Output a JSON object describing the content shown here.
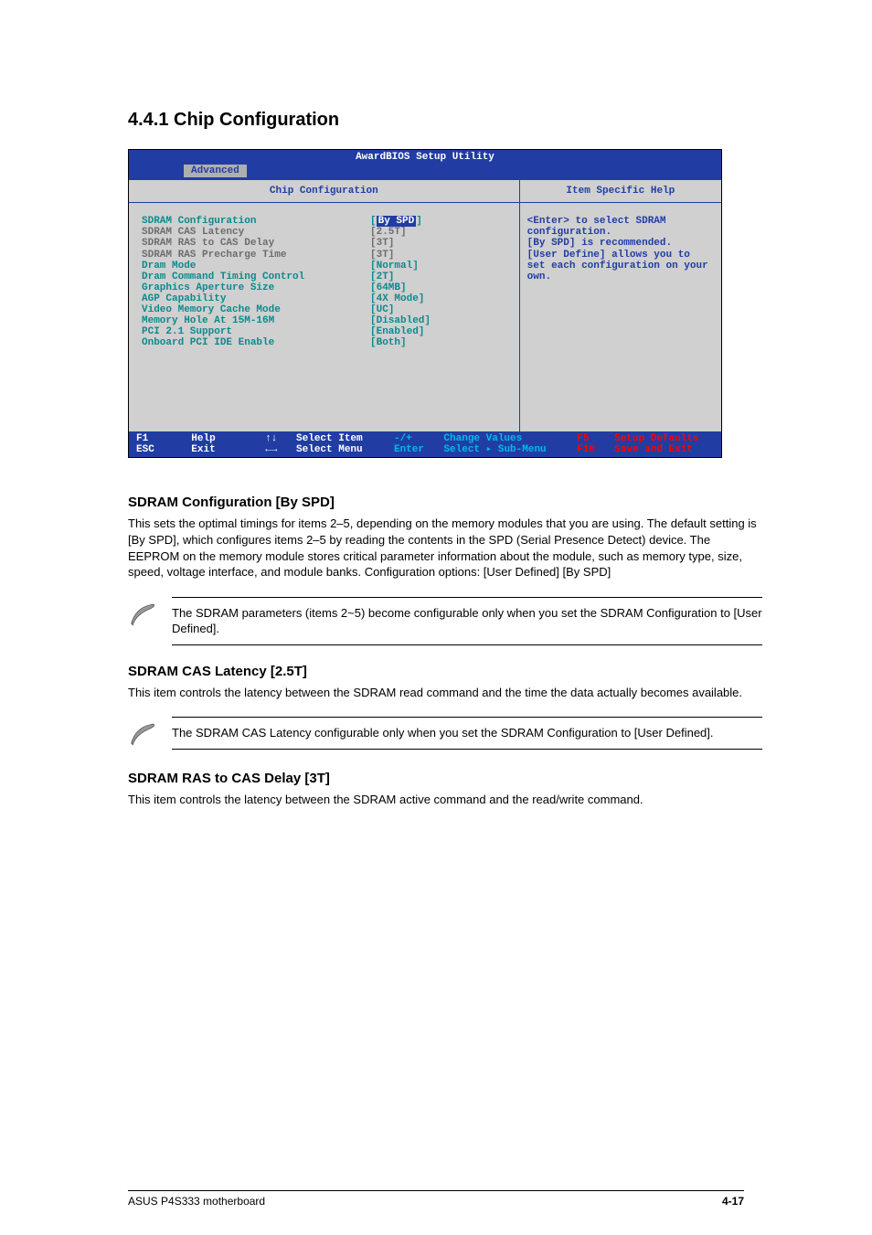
{
  "heading": "4.4.1 Chip Configuration",
  "bios": {
    "title": "AwardBIOS Setup Utility",
    "tab": "Advanced",
    "col_left": "Chip Configuration",
    "col_right": "Item Specific Help",
    "rows": [
      {
        "label": "SDRAM Configuration",
        "value": "[",
        "hl": "By SPD",
        "close": "]",
        "dim": false
      },
      {
        "label": "SDRAM CAS Latency",
        "value": "[2.5T]",
        "dim": true
      },
      {
        "label": "SDRAM RAS to CAS Delay",
        "value": "[3T]",
        "dim": true
      },
      {
        "label": "SDRAM RAS Precharge Time",
        "value": "[3T]",
        "dim": true
      },
      {
        "label": "Dram Mode",
        "value": "[Normal]",
        "dim": false
      },
      {
        "label": "Dram Command Timing Control",
        "value": "[2T]",
        "dim": false
      },
      {
        "label": "Graphics Aperture Size",
        "value": "[64MB]",
        "dim": false
      },
      {
        "label": "AGP Capability",
        "value": "[4X Mode]",
        "dim": false
      },
      {
        "label": "Video Memory Cache Mode",
        "value": "[UC]",
        "dim": false
      },
      {
        "label": "Memory Hole At 15M-16M",
        "value": "[Disabled]",
        "dim": false
      },
      {
        "label": "PCI 2.1 Support",
        "value": "[Enabled]",
        "dim": false
      },
      {
        "label": "Onboard PCI IDE Enable",
        "value": "[Both]",
        "dim": false
      }
    ],
    "help_text": "<Enter> to select SDRAM configuration.\n[By SPD] is recommended.\n[User Define] allows you to set each configuration on your own.",
    "footer": {
      "f1": "F1",
      "help": "Help",
      "esc": "ESC",
      "exit": "Exit",
      "up": "↑↓",
      "sel_item": "Select Item",
      "lr": "←→",
      "sel_menu": "Select Menu",
      "pm": "-/+",
      "chg": "Change Values",
      "enter": "Enter",
      "sub": "Select ▸ Sub-Menu",
      "f5": "F5",
      "defaults": "Setup Defaults",
      "f10": "F10",
      "save": "Save and Exit"
    }
  },
  "sdram_cfg": {
    "title": "SDRAM Configuration [By SPD]",
    "p1": "This sets the optimal timings for items 2–5, depending on the memory modules that you are using. The default setting is [By SPD], which configures items 2–5 by reading the contents in the SPD (Serial Presence Detect) device. The EEPROM on the memory module stores critical parameter information about the module, such as memory type, size, speed, voltage interface, and module banks. Configuration options: [User Defined] [By SPD]",
    "note": "The SDRAM parameters (items 2~5) become configurable only when you set the SDRAM Configuration to [User Defined]."
  },
  "cas": {
    "title": "SDRAM CAS Latency [2.5T]",
    "p1": "This item controls the latency between the SDRAM read command and the time the data actually becomes available.",
    "note": "The SDRAM CAS Latency configurable only when you set the SDRAM Configuration to [User Defined]."
  },
  "ras": {
    "title": "SDRAM RAS to CAS Delay [3T]",
    "p1": "This item controls the latency between the SDRAM active command and the read/write command."
  },
  "footer": {
    "left": "ASUS P4S333 motherboard",
    "right": "4-17"
  }
}
